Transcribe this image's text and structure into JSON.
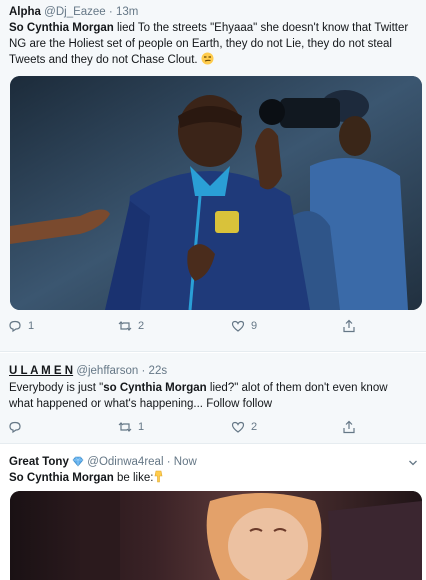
{
  "tweets": [
    {
      "name": "Alpha",
      "handle": "@Dj_Eazee",
      "sep": "·",
      "time": "13m",
      "text_bold": "So Cynthia Morgan",
      "text_rest": " lied To the streets \"Ehyaaa\" she doesn't know that Twitter NG are the Holiest set of people on Earth, they do not Lie, they do not steal Tweets and they do not Chase Clout.",
      "counts": {
        "reply": "1",
        "retweet": "2",
        "like": "9"
      }
    },
    {
      "name": "U L A M E N",
      "handle": "@jehffarson",
      "sep": "·",
      "time": "22s",
      "text_pre": "Everybody is just \"",
      "text_bold": "so Cynthia Morgan",
      "text_post": " lied?\" alot of them don't even know what happened or what's happening... Follow follow",
      "counts": {
        "reply": "",
        "retweet": "1",
        "like": "2"
      }
    },
    {
      "name": "Great Tony",
      "handle": "@Odinwa4real",
      "sep": "·",
      "time": "Now",
      "text_bold": "So Cynthia Morgan",
      "text_rest": " be like:"
    }
  ],
  "icons": {
    "reply": "reply-icon",
    "retweet": "retweet-icon",
    "like": "heart-icon",
    "share": "share-icon",
    "caret": "chevron-down-icon",
    "verified": "diamond-icon"
  },
  "colors": {
    "meta": "#657786",
    "text": "#14171a",
    "hover_bg": "#f5f8fa"
  }
}
